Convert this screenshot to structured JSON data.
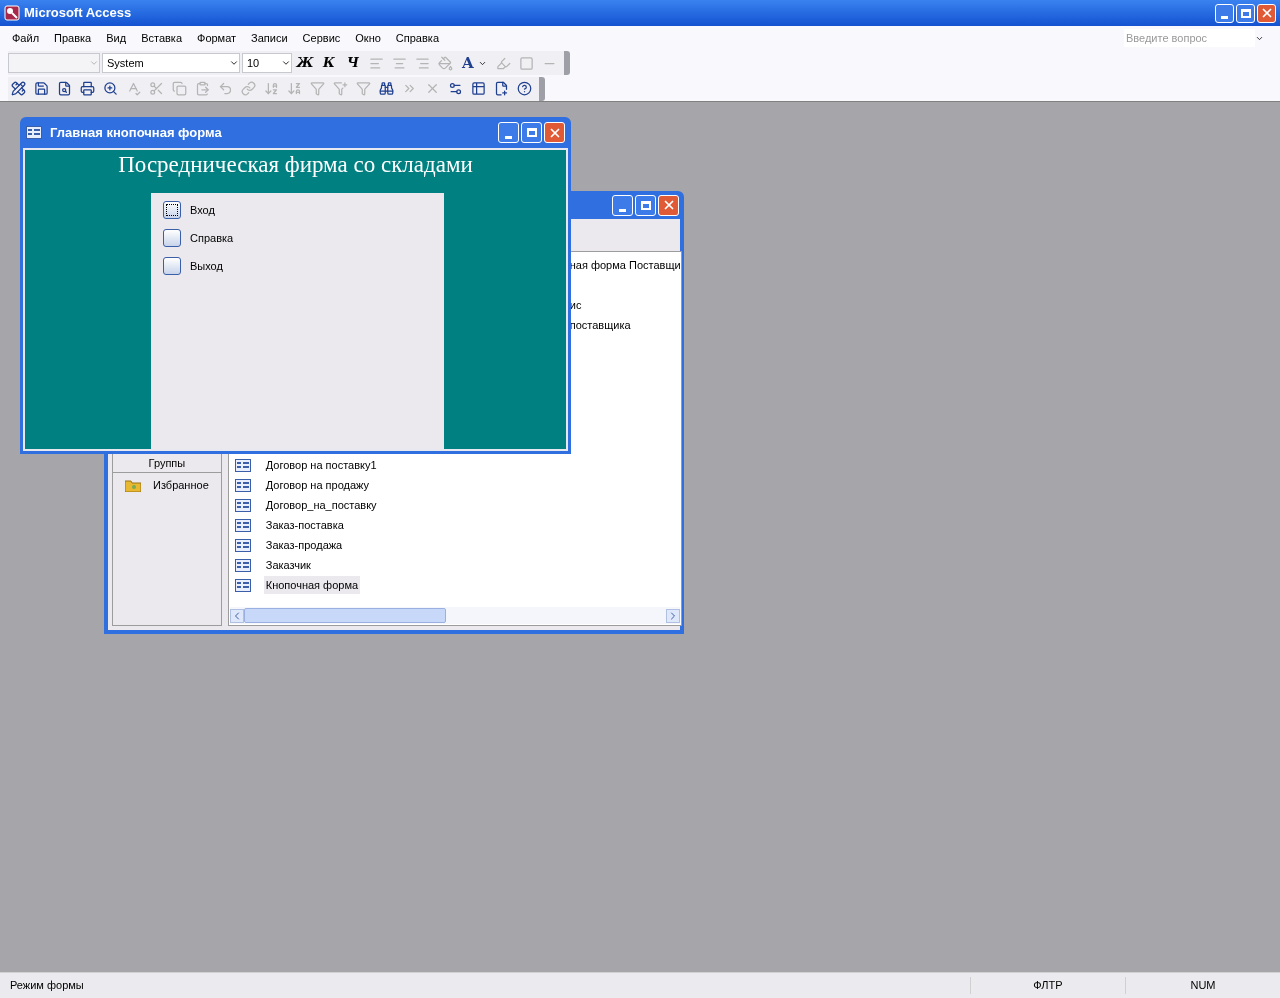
{
  "window": {
    "title": "Microsoft Access"
  },
  "menu": [
    "Файл",
    "Правка",
    "Вид",
    "Вставка",
    "Формат",
    "Записи",
    "Сервис",
    "Окно",
    "Справка"
  ],
  "help_search": {
    "placeholder": "Введите вопрос"
  },
  "formatting_toolbar": [
    {
      "kind": "combo",
      "disabled": true
    },
    {
      "kind": "combo",
      "value": "System",
      "disabled": false
    },
    {
      "kind": "combo",
      "value": "10",
      "disabled": false
    },
    {
      "kind": "letter",
      "label": "Ж",
      "disabled": false
    },
    {
      "kind": "letter",
      "label": "К",
      "disabled": false
    },
    {
      "kind": "letter",
      "label": "Ч",
      "disabled": false
    },
    {
      "kind": "align-left",
      "disabled": true
    },
    {
      "kind": "align-center",
      "disabled": true
    },
    {
      "kind": "align-right",
      "disabled": true
    },
    {
      "kind": "fill",
      "disabled": true
    },
    {
      "kind": "font-color",
      "label": "A",
      "disabled": false
    },
    {
      "kind": "line-color",
      "disabled": true
    },
    {
      "kind": "border",
      "disabled": true
    },
    {
      "kind": "line-width",
      "disabled": true
    }
  ],
  "database_toolbar": [
    {
      "kind": "design",
      "disabled": false
    },
    {
      "kind": "save",
      "disabled": false
    },
    {
      "kind": "search-file",
      "disabled": false
    },
    {
      "kind": "print",
      "disabled": false
    },
    {
      "kind": "preview",
      "disabled": false
    },
    {
      "kind": "spelling",
      "disabled": true
    },
    {
      "kind": "cut",
      "disabled": true
    },
    {
      "kind": "copy",
      "disabled": true
    },
    {
      "kind": "paste",
      "disabled": true
    },
    {
      "kind": "undo",
      "disabled": true
    },
    {
      "kind": "link",
      "disabled": true
    },
    {
      "kind": "sort-asc",
      "disabled": true
    },
    {
      "kind": "sort-desc",
      "disabled": true
    },
    {
      "kind": "filter-selection",
      "disabled": true
    },
    {
      "kind": "filter-form",
      "disabled": true
    },
    {
      "kind": "filter",
      "disabled": true
    },
    {
      "kind": "find",
      "disabled": false
    },
    {
      "kind": "new-record",
      "disabled": true
    },
    {
      "kind": "delete-record",
      "disabled": true
    },
    {
      "kind": "properties",
      "disabled": false
    },
    {
      "kind": "database-window",
      "disabled": false
    },
    {
      "kind": "new-object",
      "disabled": false
    },
    {
      "kind": "help",
      "disabled": false
    }
  ],
  "database_window": {
    "groups_header": "Группы",
    "groups": [
      {
        "label": "Избранное"
      }
    ],
    "partial_items": [
      {
        "text": "ная форма Поставщи"
      },
      {
        "text": "ис"
      },
      {
        "text": "поставщика"
      }
    ],
    "items": [
      {
        "label": "Договор на поставку1",
        "selected": false
      },
      {
        "label": "Договор на продажу",
        "selected": false
      },
      {
        "label": "Договор_на_поставку",
        "selected": false
      },
      {
        "label": "Заказ-поставка",
        "selected": false
      },
      {
        "label": "Заказ-продажа",
        "selected": false
      },
      {
        "label": "Заказчик",
        "selected": false
      },
      {
        "label": "Кнопочная форма",
        "selected": true
      }
    ]
  },
  "switchboard": {
    "title": "Главная кнопочная форма",
    "heading": "Посредническая фирма со складами",
    "buttons": [
      {
        "label": "Вход",
        "focused": true
      },
      {
        "label": "Справка",
        "focused": false
      },
      {
        "label": "Выход",
        "focused": false
      }
    ]
  },
  "status_bar": {
    "mode": "Режим формы",
    "indicators": [
      {
        "label": "ФЛТР"
      },
      {
        "label": "NUM"
      }
    ]
  }
}
